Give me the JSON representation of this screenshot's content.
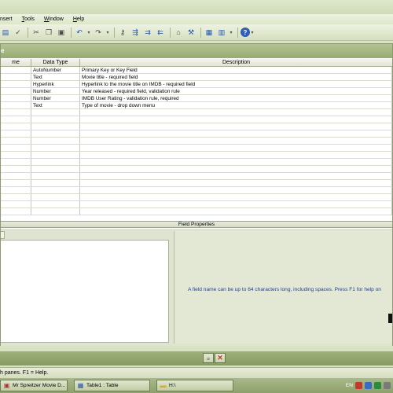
{
  "menu": [
    {
      "label": "nsert",
      "u": ""
    },
    {
      "label": "ools",
      "u": "T"
    },
    {
      "label": "indow",
      "u": "W"
    },
    {
      "label": "elp",
      "u": "H"
    }
  ],
  "window": {
    "title": "e"
  },
  "grid": {
    "headers": [
      "me",
      "Data Type",
      "Description"
    ],
    "rows": [
      {
        "type": "AutoNumber",
        "desc": "Primary Key or Key Field"
      },
      {
        "type": "Text",
        "desc": "Movie title - required field"
      },
      {
        "type": "Hyperlink",
        "desc": "Hyperlink to the movie title on IMDB - required field"
      },
      {
        "type": "Number",
        "desc": "Year released - required field, validation rule"
      },
      {
        "type": "Number",
        "desc": "IMDB User Rating  - validation rule, required"
      },
      {
        "type": "Text",
        "desc": "Type of movie - drop down menu"
      }
    ]
  },
  "field_properties": {
    "title": "Field Properties",
    "help_text": "A field name can be up to 64 characters long, including spaces.  Press F1 for help on"
  },
  "status": {
    "text": "h panes.  F1 = Help."
  },
  "taskbar": {
    "tasks": [
      "Mr Spreitzer Movie D...",
      "Table1 : Table",
      "H:\\"
    ],
    "tray_lang": "EN"
  },
  "colors": {
    "accent": "#97ab72",
    "help_text": "#1d3fa0",
    "close_red": "#b83c2a"
  }
}
